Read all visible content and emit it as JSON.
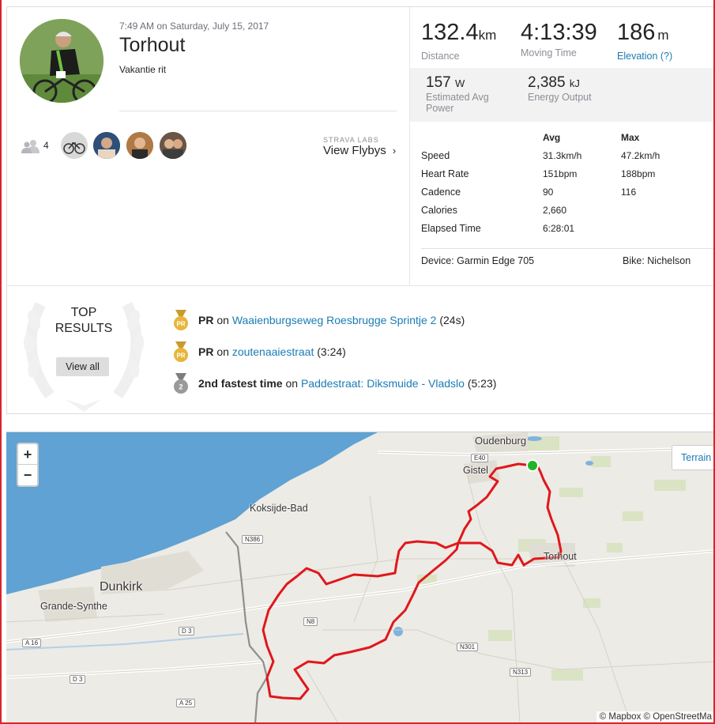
{
  "activity": {
    "datetime": "7:49 AM on Saturday, July 15, 2017",
    "title": "Torhout",
    "description": "Vakantie rit",
    "group_count": "4"
  },
  "flybys": {
    "lab": "STRAVA LABS",
    "link": "View Flybys"
  },
  "stats": {
    "distance": {
      "value": "132.4",
      "unit": "km",
      "label": "Distance"
    },
    "moving_time": {
      "value": "4:13:39",
      "label": "Moving Time"
    },
    "elevation": {
      "value": "186",
      "unit": "m",
      "label": "Elevation (?)"
    },
    "power": {
      "value": "157",
      "unit": "W",
      "label1": "Estimated Avg",
      "label2": "Power"
    },
    "energy": {
      "value": "2,385",
      "unit": "kJ",
      "label": "Energy Output"
    }
  },
  "table": {
    "headers": [
      "",
      "Avg",
      "Max"
    ],
    "rows": [
      [
        "Speed",
        "31.3km/h",
        "47.2km/h"
      ],
      [
        "Heart Rate",
        "151bpm",
        "188bpm"
      ],
      [
        "Cadence",
        "90",
        "116"
      ],
      [
        "Calories",
        "2,660",
        ""
      ],
      [
        "Elapsed Time",
        "6:28:01",
        ""
      ]
    ]
  },
  "device": "Device: Garmin Edge 705",
  "bike": "Bike: Nichelson",
  "top_results": {
    "title_line1": "TOP",
    "title_line2": "RESULTS",
    "view_all": "View all",
    "items": [
      {
        "badge": "PR",
        "prefix": "PR",
        "on": "on",
        "segment": "Waaienburgseweg Roesbrugge Sprintje 2",
        "time": "(24s)",
        "color": "#e8b53c"
      },
      {
        "badge": "PR",
        "prefix": "PR",
        "on": "on",
        "segment": "zoutenaaiestraat",
        "time": "(3:24)",
        "color": "#e8b53c"
      },
      {
        "badge": "2",
        "prefix": "2nd fastest time",
        "on": "on",
        "segment": "Paddestraat: Diksmuide - Vladslo",
        "time": "(5:23)",
        "color": "#9a9a9a"
      }
    ]
  },
  "map": {
    "zoom_in": "+",
    "zoom_out": "−",
    "terrain": "Terrain",
    "attribution1": "© Mapbox",
    "attribution2": "© OpenStreetMa",
    "places": {
      "oudenburg": "Oudenburg",
      "gistel": "Gistel",
      "koksijde": "Koksijde-Bad",
      "dunkirk": "Dunkirk",
      "grande_synthe": "Grande-Synthe",
      "torhout": "Torhout"
    },
    "roads": {
      "e40": "E40",
      "n386": "N386",
      "d3a": "D 3",
      "a16": "A 16",
      "d3b": "D 3",
      "n8": "N8",
      "n301": "N301",
      "n313": "N313",
      "a25": "A 25"
    },
    "route_color": "#e0171c",
    "start_color": "#1eb627"
  }
}
